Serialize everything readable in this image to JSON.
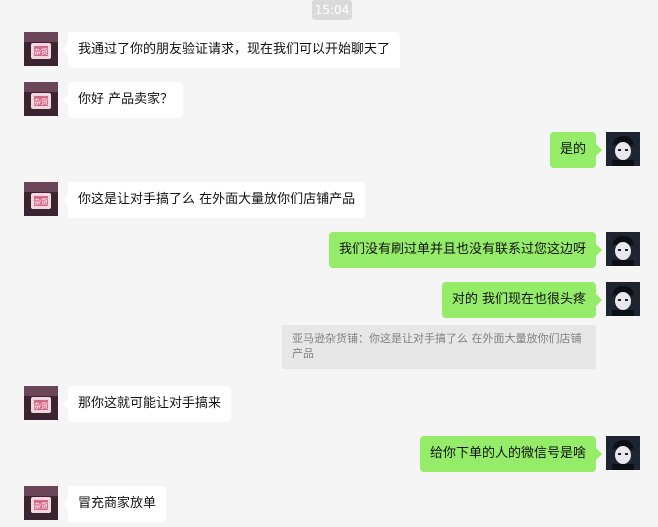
{
  "timestamp": "15:04",
  "messages": [
    {
      "side": "in",
      "text": "我通过了你的朋友验证请求，现在我们可以开始聊天了"
    },
    {
      "side": "in",
      "text": "你好 产品卖家？"
    },
    {
      "side": "out",
      "text": "是的"
    },
    {
      "side": "in",
      "text": "你这是让对手搞了么 在外面大量放你们店铺产品"
    },
    {
      "side": "out",
      "text": "我们没有刷过单并且也没有联系过您这边呀"
    },
    {
      "side": "out",
      "text": "对的 我们现在也很头疼"
    },
    {
      "side": "in",
      "text": "那你这就可能让对手搞来"
    },
    {
      "side": "out",
      "text": "给你下单的人的微信号是啥"
    },
    {
      "side": "in",
      "text": "冒充商家放单"
    }
  ],
  "quote": {
    "text": "亚马逊杂货铺：你这是让对手搞了么 在外面大量放你们店铺产品"
  },
  "avatars": {
    "contact": {
      "label": "杂货",
      "bg_color": "#3a2430",
      "accent": "#d46a8a"
    },
    "self": {
      "bg_color": "#1f2530",
      "accent": "#e8e8f0"
    }
  }
}
